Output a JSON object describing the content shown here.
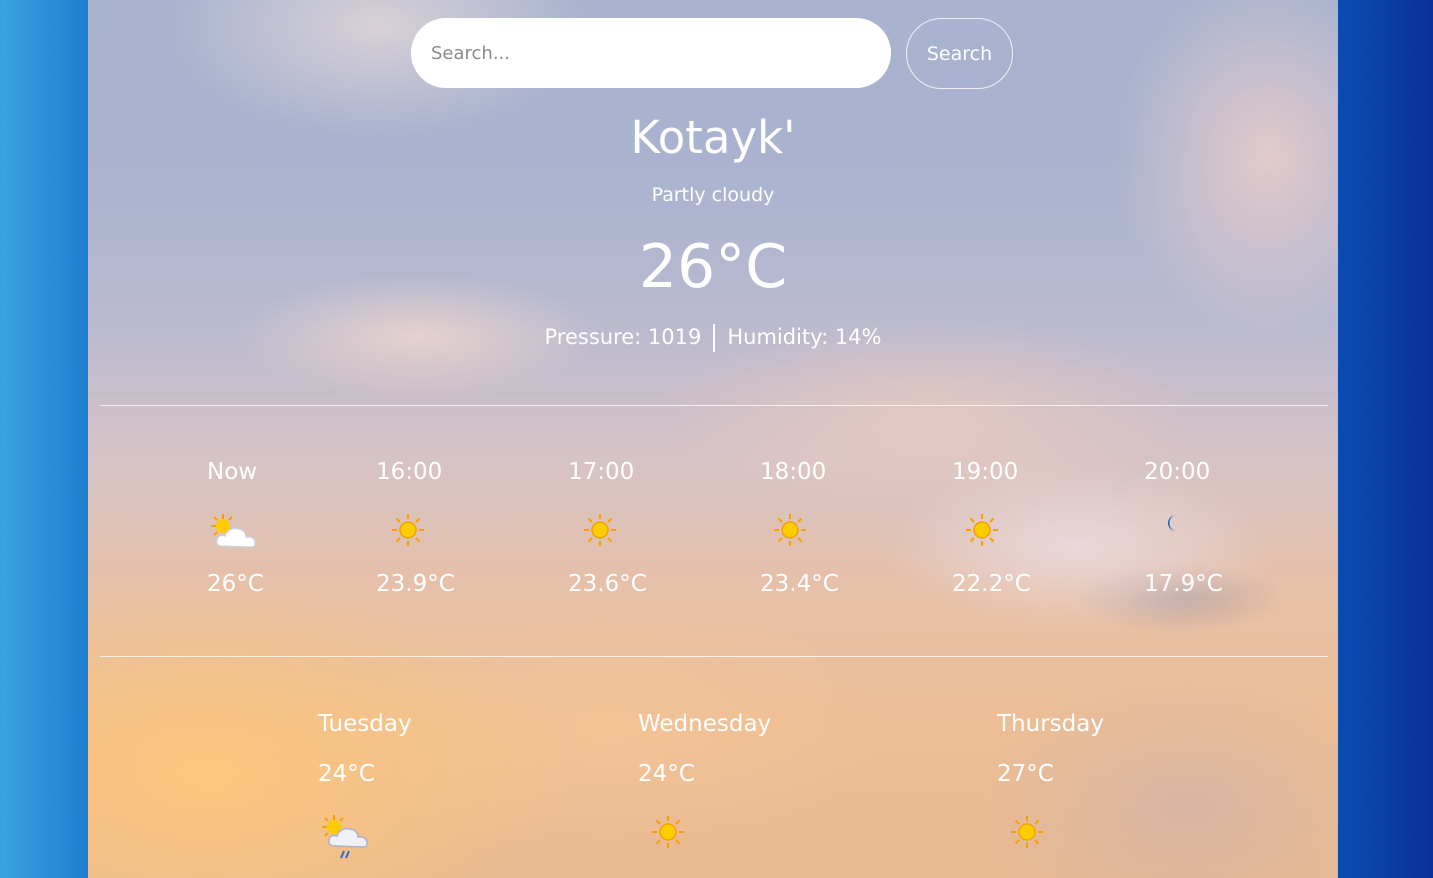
{
  "search": {
    "placeholder": "Search...",
    "button_label": "Search"
  },
  "current": {
    "city": "Kotayk'",
    "condition": "Partly cloudy",
    "temperature": "26°C",
    "pressure": "Pressure: 1019",
    "humidity": "Humidity: 14%"
  },
  "hourly": [
    {
      "time": "Now",
      "icon": "partly-cloudy-icon",
      "temp": "26°C"
    },
    {
      "time": "16:00",
      "icon": "sun-icon",
      "temp": "23.9°C"
    },
    {
      "time": "17:00",
      "icon": "sun-icon",
      "temp": "23.6°C"
    },
    {
      "time": "18:00",
      "icon": "sun-icon",
      "temp": "23.4°C"
    },
    {
      "time": "19:00",
      "icon": "sun-icon",
      "temp": "22.2°C"
    },
    {
      "time": "20:00",
      "icon": "moon-icon",
      "temp": "17.9°C"
    }
  ],
  "daily": [
    {
      "day": "Tuesday",
      "temp": "24°C",
      "icon": "sun-cloud-rain-icon"
    },
    {
      "day": "Wednesday",
      "temp": "24°C",
      "icon": "sun-icon"
    },
    {
      "day": "Thursday",
      "temp": "27°C",
      "icon": "sun-icon"
    }
  ],
  "colors": {
    "sun": "#ffcc00",
    "sun_rays": "#f5a000",
    "moon": "#1565c0",
    "rain": "#2f6fd0"
  }
}
